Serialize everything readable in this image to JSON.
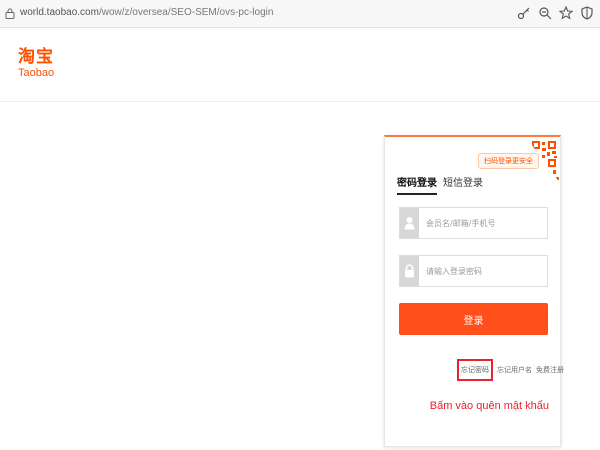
{
  "browser": {
    "url_host": "world.taobao.com",
    "url_path": "/wow/z/oversea/SEO-SEM/ovs-pc-login",
    "icons": [
      "key-icon",
      "zoom-icon",
      "star-icon",
      "shield-icon"
    ]
  },
  "header": {
    "logo_cn": "淘宝",
    "logo_en": "Taobao"
  },
  "login": {
    "qr_tip": "扫码登录更安全",
    "tabs": [
      {
        "label": "密码登录",
        "active": true
      },
      {
        "label": "短信登录",
        "active": false
      }
    ],
    "username_placeholder": "会员名/邮箱/手机号",
    "password_placeholder": "请输入登录密码",
    "submit_label": "登录",
    "forgot_password": "忘记密码",
    "forgot_username": "忘记用户名",
    "register": "免费注册",
    "annotation": "Bấm vào quên mật khẩu"
  },
  "colors": {
    "brand": "#ff5000",
    "button": "#ff4f1a",
    "annotation": "#e8232b"
  }
}
